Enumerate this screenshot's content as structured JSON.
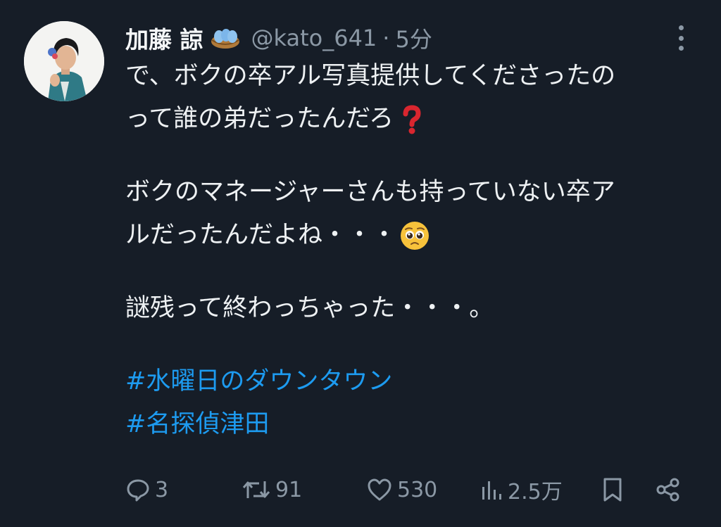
{
  "tweet": {
    "author_name": "加藤 諒",
    "handle": "@kato_641",
    "separator": "·",
    "time": "5分",
    "lines": [
      "で、ボクの卒アル写真提供してくださったの",
      "って誰の弟だったんだろ",
      "ボクのマネージャーさんも持っていない卒ア",
      "ルだったんだよね・・・",
      "謎残って終わっちゃった・・・。"
    ],
    "hashtags": [
      "#水曜日のダウンタウン",
      "#名探偵津田"
    ]
  },
  "actions": {
    "replies": "3",
    "retweets": "91",
    "likes": "530",
    "views": "2.5万"
  },
  "icons": {
    "badge": "nest-badge-icon",
    "question_emoji": "red-question-mark-icon",
    "pleading_emoji": "pleading-face-icon",
    "reply": "reply-icon",
    "retweet": "retweet-icon",
    "like": "heart-icon",
    "views": "views-icon",
    "bookmark": "bookmark-icon",
    "share": "share-icon",
    "more": "more-vertical-icon"
  },
  "colors": {
    "background": "#161d27",
    "text": "#e7e9ea",
    "muted": "#8b98a5",
    "hashtag": "#1d9bf0"
  }
}
